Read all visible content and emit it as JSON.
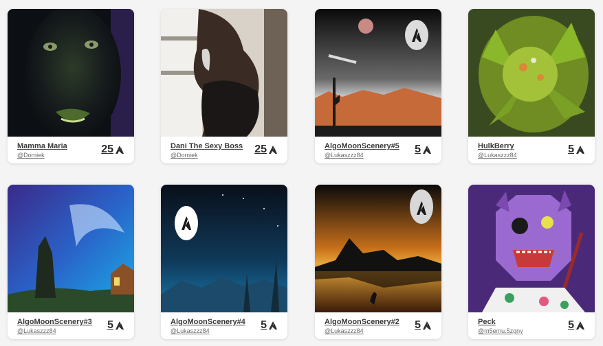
{
  "currency_icon": "algorand-icon",
  "cards": [
    {
      "title": "Mamma Maria",
      "owner": "@Domiek",
      "price": "25"
    },
    {
      "title": "Dani The Sexy Boss",
      "owner": "@Domiek",
      "price": "25"
    },
    {
      "title": "AlgoMoonScenery#5",
      "owner": "@Lukaszzz84",
      "price": "5"
    },
    {
      "title": "HulkBerry",
      "owner": "@Lukaszzz84",
      "price": "5"
    },
    {
      "title": "AlgoMoonScenery#3",
      "owner": "@Lukaszzz84",
      "price": "5"
    },
    {
      "title": "AlgoMoonScenery#4",
      "owner": "@Lukaszzz84",
      "price": "5"
    },
    {
      "title": "AlgoMoonScenery#2",
      "owner": "@Lukaszzz84",
      "price": "5"
    },
    {
      "title": "Peck",
      "owner": "@m5emu.5zgny",
      "price": "5"
    }
  ]
}
